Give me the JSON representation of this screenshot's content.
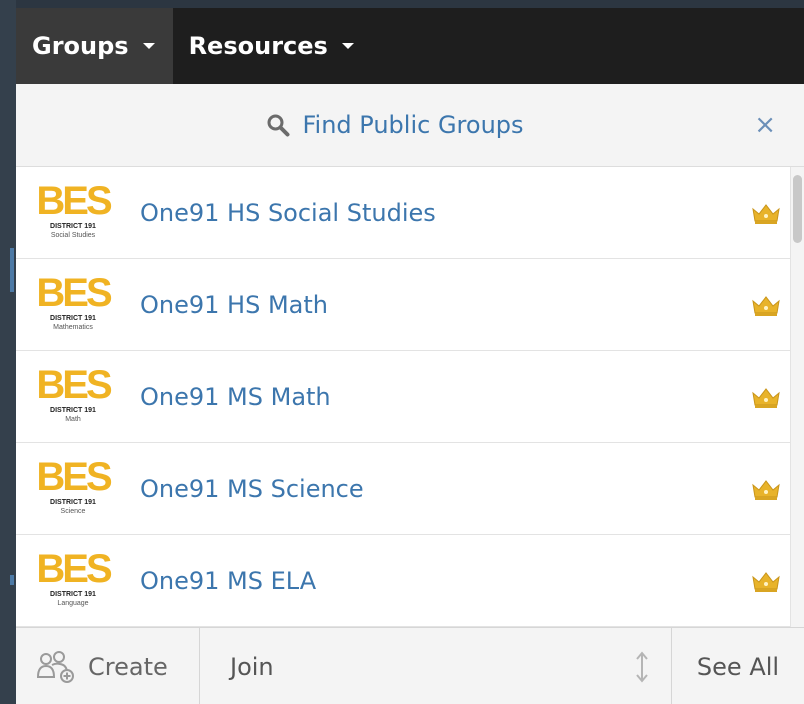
{
  "nav": {
    "groups_label": "Groups",
    "resources_label": "Resources"
  },
  "finder": {
    "label": "Find Public Groups",
    "close_glyph": "×"
  },
  "groups": [
    {
      "logo_text": "BES",
      "logo_district": "DISTRICT 191",
      "logo_subtitle": "Social Studies",
      "name": "One91 HS Social Studies",
      "badge_icon": "crown-icon"
    },
    {
      "logo_text": "BES",
      "logo_district": "DISTRICT 191",
      "logo_subtitle": "Mathematics",
      "name": "One91 HS Math",
      "badge_icon": "crown-icon"
    },
    {
      "logo_text": "BES",
      "logo_district": "DISTRICT 191",
      "logo_subtitle": "Math",
      "name": "One91 MS Math",
      "badge_icon": "crown-icon"
    },
    {
      "logo_text": "BES",
      "logo_district": "DISTRICT 191",
      "logo_subtitle": "Science",
      "name": "One91 MS Science",
      "badge_icon": "crown-icon"
    },
    {
      "logo_text": "BES",
      "logo_district": "DISTRICT 191",
      "logo_subtitle": "Language",
      "name": "One91 MS ELA",
      "badge_icon": "crown-icon"
    }
  ],
  "footer": {
    "create_label": "Create",
    "join_label": "Join",
    "see_all_label": "See All"
  },
  "colors": {
    "link_blue": "#3c76ad",
    "logo_gold": "#f0b323",
    "crown_gold": "#e8b32a",
    "nav_bg": "#1e1e1e"
  }
}
